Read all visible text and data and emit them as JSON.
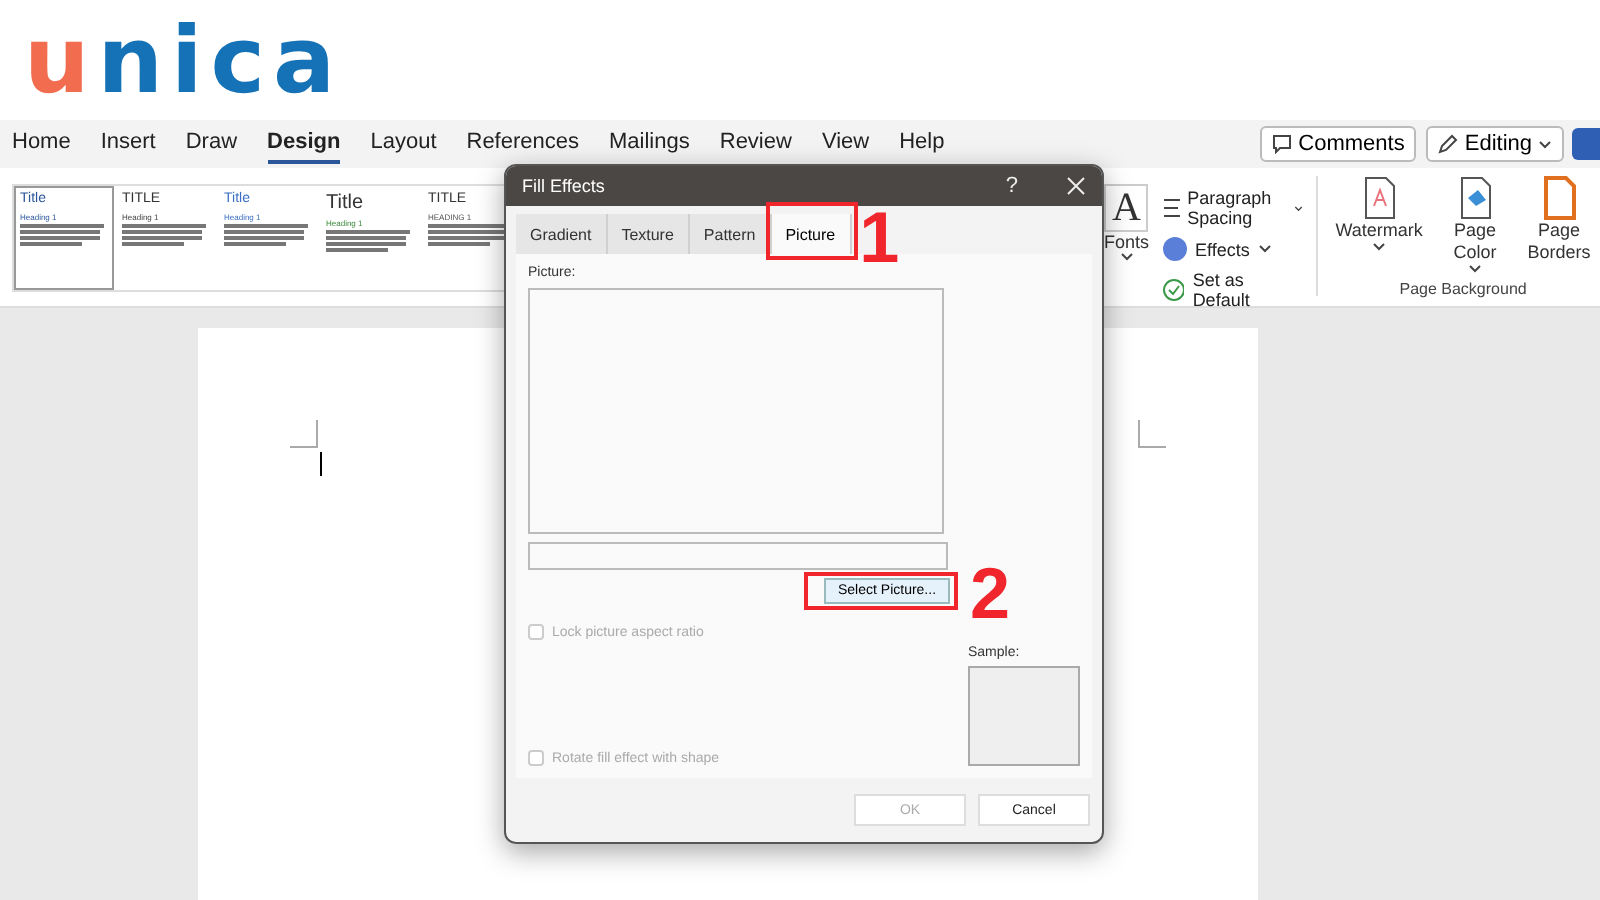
{
  "logo": [
    {
      "text": "u",
      "color": "#f26d50"
    },
    {
      "text": "nica",
      "color": "#1672b6"
    }
  ],
  "menu": [
    {
      "label": "Home",
      "selected": false
    },
    {
      "label": "Insert",
      "selected": false
    },
    {
      "label": "Draw",
      "selected": false
    },
    {
      "label": "Design",
      "selected": true
    },
    {
      "label": "Layout",
      "selected": false
    },
    {
      "label": "References",
      "selected": false
    },
    {
      "label": "Mailings",
      "selected": false
    },
    {
      "label": "Review",
      "selected": false
    },
    {
      "label": "View",
      "selected": false
    },
    {
      "label": "Help",
      "selected": false
    }
  ],
  "header_buttons": [
    {
      "kind": "comments",
      "label": "Comments"
    },
    {
      "kind": "editing",
      "label": "Editing"
    }
  ],
  "style_gallery": [
    {
      "title": "Title",
      "heading": "Heading 1",
      "selected": true
    },
    {
      "title": "TITLE",
      "heading": "Heading 1",
      "selected": false
    },
    {
      "title": "Title",
      "heading": "Heading 1",
      "selected": false
    },
    {
      "title": "Title",
      "heading": "Heading 1",
      "selected": false
    },
    {
      "title": "TITLE",
      "heading": "HEADING 1",
      "selected": false
    }
  ],
  "fonts": {
    "glyph": "A",
    "label": "Fonts"
  },
  "design_commands": [
    {
      "kind": "spacing",
      "label": "Paragraph Spacing",
      "dropdown": true
    },
    {
      "kind": "effects",
      "label": "Effects",
      "dropdown": true
    },
    {
      "kind": "default",
      "label": "Set as Default",
      "dropdown": false
    }
  ],
  "page_background": {
    "items": [
      {
        "kind": "watermark",
        "label": "Watermark"
      },
      {
        "kind": "color",
        "label": "Page Color"
      },
      {
        "kind": "borders",
        "label": "Page Borders"
      }
    ],
    "group_label": "Page Background"
  },
  "dialog": {
    "title": "Fill Effects",
    "help": "?",
    "tabs": [
      {
        "label": "Gradient",
        "selected": false
      },
      {
        "label": "Texture",
        "selected": false
      },
      {
        "label": "Pattern",
        "selected": false
      },
      {
        "label": "Picture",
        "selected": true
      }
    ],
    "picture_label": "Picture:",
    "select_button": "Select Picture...",
    "options": [
      {
        "label": "Lock picture aspect ratio",
        "checked": false,
        "disabled": true
      },
      {
        "label": "Rotate fill effect with shape",
        "checked": false,
        "disabled": true
      }
    ],
    "sample_label": "Sample:",
    "buttons": [
      {
        "label": "OK",
        "disabled": true
      },
      {
        "label": "Cancel",
        "disabled": false
      }
    ]
  },
  "annotations": [
    "1",
    "2"
  ]
}
